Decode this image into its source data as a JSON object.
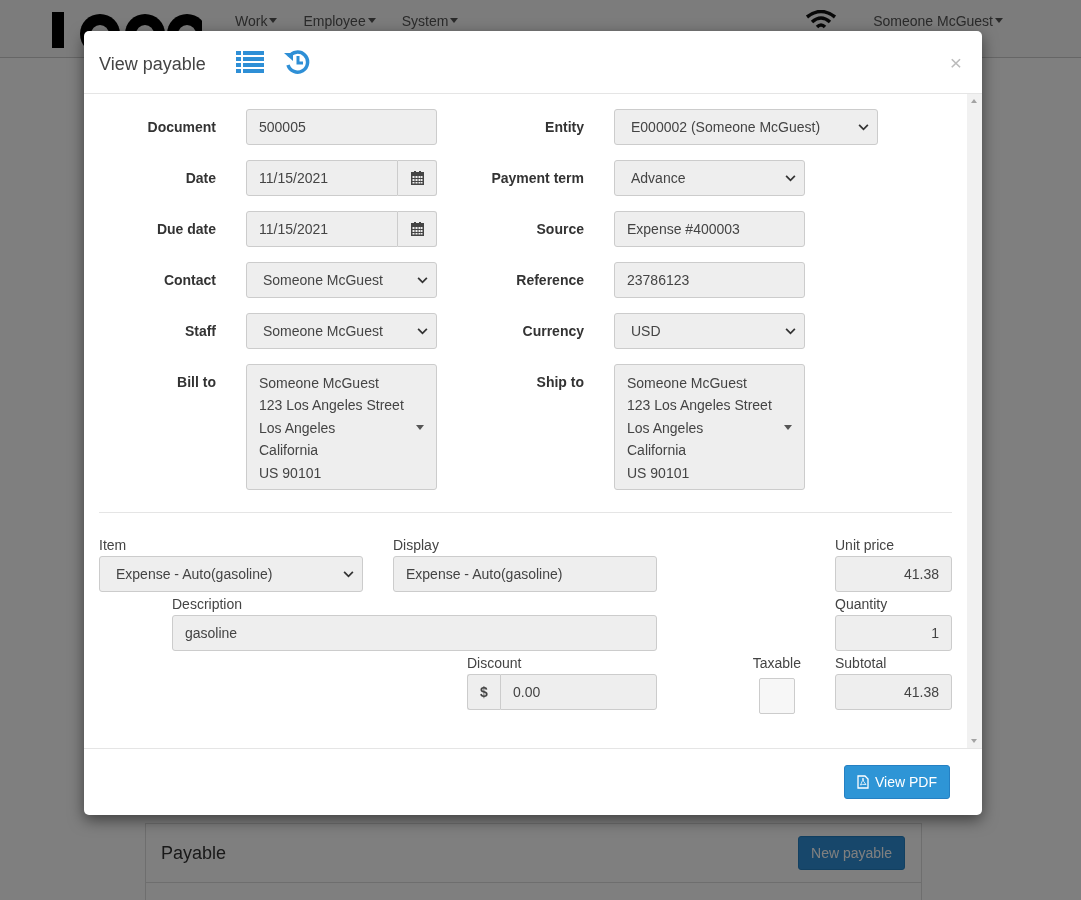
{
  "navbar": {
    "menus": [
      {
        "label": "Work"
      },
      {
        "label": "Employee"
      },
      {
        "label": "System"
      }
    ],
    "user": "Someone McGuest"
  },
  "page": {
    "panel_title": "Payable",
    "new_button": "New payable"
  },
  "modal": {
    "title": "View payable",
    "close": "×",
    "fields": [
      {
        "label": "Document",
        "kind": "text",
        "value": "500005"
      },
      {
        "label": "Entity",
        "kind": "select",
        "value": "E000002 (Someone McGuest)",
        "wide": true
      },
      {
        "label": "Date",
        "kind": "date",
        "value": "11/15/2021"
      },
      {
        "label": "Payment term",
        "kind": "select",
        "value": "Advance"
      },
      {
        "label": "Due date",
        "kind": "date",
        "value": "11/15/2021"
      },
      {
        "label": "Source",
        "kind": "text",
        "value": "Expense #400003"
      },
      {
        "label": "Contact",
        "kind": "select",
        "value": "Someone McGuest"
      },
      {
        "label": "Reference",
        "kind": "text",
        "value": "23786123"
      },
      {
        "label": "Staff",
        "kind": "select",
        "value": "Someone McGuest"
      },
      {
        "label": "Currency",
        "kind": "select",
        "value": "USD"
      },
      {
        "label": "Bill to",
        "kind": "address",
        "value": "Someone McGuest\n123 Los Angeles Street\nLos Angeles\nCalifornia\nUS 90101"
      },
      {
        "label": "Ship to",
        "kind": "address",
        "value": "Someone McGuest\n123 Los Angeles Street\nLos Angeles\nCalifornia\nUS 90101"
      }
    ],
    "line": {
      "item": {
        "label": "Item",
        "value": "Expense - Auto(gasoline)"
      },
      "display": {
        "label": "Display",
        "value": "Expense - Auto(gasoline)"
      },
      "unit_price": {
        "label": "Unit price",
        "value": "41.38"
      },
      "description": {
        "label": "Description",
        "value": "gasoline"
      },
      "quantity": {
        "label": "Quantity",
        "value": "1"
      },
      "discount": {
        "label": "Discount",
        "prefix": "$",
        "value": "0.00"
      },
      "taxable": {
        "label": "Taxable",
        "checked": false
      },
      "subtotal": {
        "label": "Subtotal",
        "value": "41.38"
      }
    },
    "footer_button": "View PDF"
  }
}
